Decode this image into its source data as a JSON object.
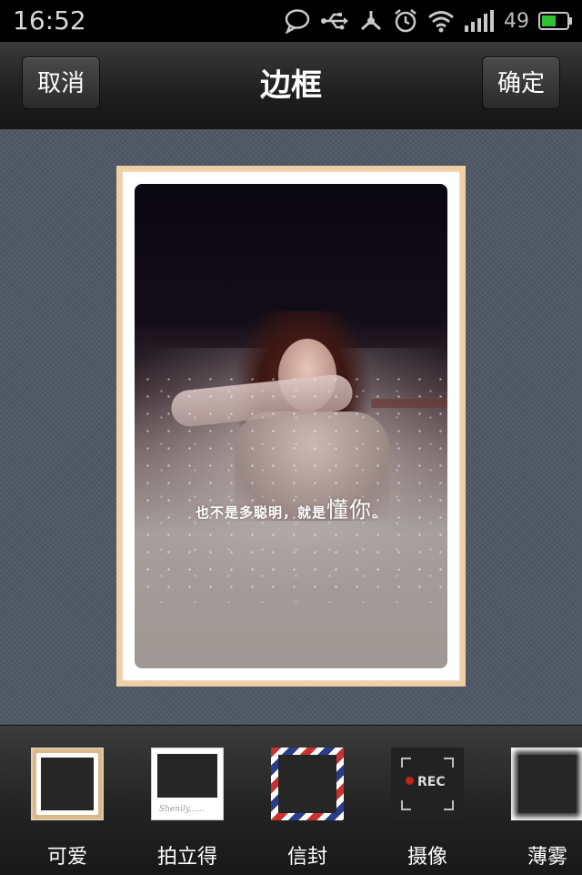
{
  "status_bar": {
    "time": "16:52",
    "battery_percent": "49",
    "icons": [
      "chat-bubble-icon",
      "usb-icon",
      "network-share-icon",
      "alarm-clock-icon",
      "wifi-icon",
      "signal-bars-icon",
      "battery-icon"
    ],
    "battery_color": "#2fc12f"
  },
  "nav": {
    "cancel_label": "取消",
    "title": "边框",
    "confirm_label": "确定"
  },
  "preview": {
    "caption_main": "也不是多聪明，就是",
    "caption_big": "懂你",
    "caption_end": "。",
    "frame_color": "#eecfa6"
  },
  "frames": {
    "items": [
      {
        "label": "可爱"
      },
      {
        "label": "拍立得",
        "thumb_text": "Shenily......"
      },
      {
        "label": "信封"
      },
      {
        "label": "摄像",
        "thumb_text": "REC"
      },
      {
        "label": "薄雾"
      }
    ]
  }
}
